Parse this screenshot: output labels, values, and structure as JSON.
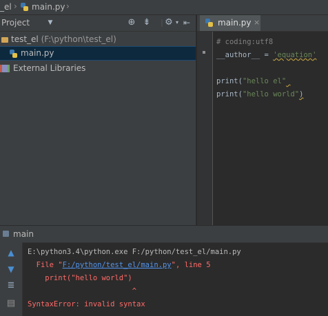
{
  "navbar": {
    "project": "_el",
    "file": "main.py"
  },
  "project_panel": {
    "title": "Project",
    "dropdown_icon": "chevron-down-icon",
    "tools": [
      "locate-icon",
      "collapse-all-icon",
      "gear-icon",
      "hide-icon"
    ],
    "tree": [
      {
        "label": "test_el",
        "path": "(F:\\python\\test_el)"
      },
      {
        "label": "main.py"
      },
      {
        "label": "External Libraries"
      }
    ]
  },
  "editor": {
    "tab_label": "main.py",
    "tab_close": "×",
    "lines": {
      "l1": "# coding:utf8",
      "l2_a": "__author__ = ",
      "l2_b": "'equation'",
      "l4_a": "print(",
      "l4_b": "\"hello el\"",
      "l5_a": "print(",
      "l5_b": "\"hello world\"",
      "l5_c": ")"
    }
  },
  "run_panel": {
    "title": "main",
    "output": {
      "cmd": "E:\\python3.4\\python.exe F:/python/test_el/main.py",
      "file_prefix": "  File \"",
      "file_link": "F:/python/test_el/main.py",
      "file_suffix": "\", line 5",
      "code_line": "    print(\"hello world\")",
      "caret": "                        ^",
      "error": "SyntaxError: invalid syntax"
    }
  },
  "colors": {
    "background": "#2b2b2b",
    "panel": "#3c3f41",
    "selection": "#0d293e",
    "error": "#ff6b68",
    "string": "#6a8759",
    "link": "#5394ec"
  }
}
